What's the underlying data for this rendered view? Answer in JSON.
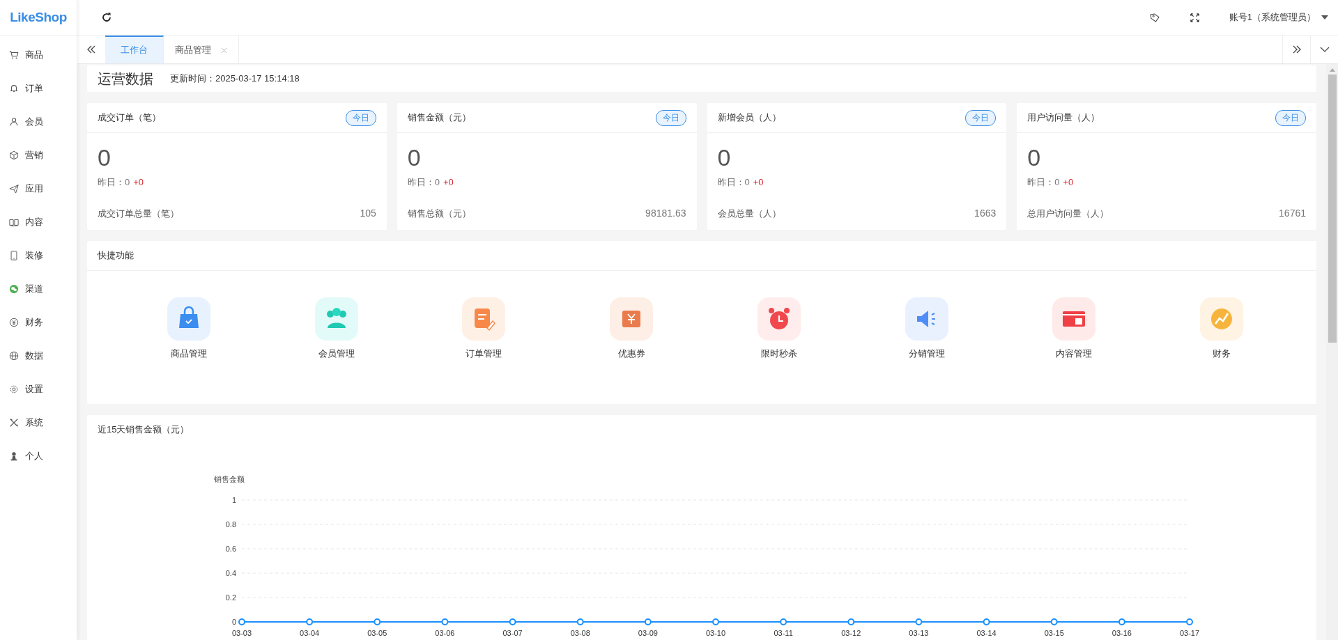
{
  "logo": {
    "part_1": "Like",
    "part_2": "Shop"
  },
  "sidebar": {
    "items": [
      {
        "label": "商品"
      },
      {
        "label": "订单"
      },
      {
        "label": "会员"
      },
      {
        "label": "营销"
      },
      {
        "label": "应用"
      },
      {
        "label": "内容"
      },
      {
        "label": "装修"
      },
      {
        "label": "渠道"
      },
      {
        "label": "财务"
      },
      {
        "label": "数据"
      },
      {
        "label": "设置"
      },
      {
        "label": "系统"
      },
      {
        "label": "个人"
      }
    ]
  },
  "header": {
    "account": "账号1（系统管理员）"
  },
  "tabs": [
    {
      "label": "工作台",
      "selected": true,
      "closable": false
    },
    {
      "label": "商品管理",
      "selected": false,
      "closable": true
    }
  ],
  "overview": {
    "title": "运营数据",
    "update_label": "更新时间：",
    "update_time": "2025-03-17 15:14:18"
  },
  "stats": [
    {
      "title": "成交订单（笔）",
      "badge": "今日",
      "value": "0",
      "yesterday_label": "昨日：",
      "yesterday_value": "0",
      "delta": "+0",
      "total_label": "成交订单总量（笔）",
      "total": "105"
    },
    {
      "title": "销售金额（元）",
      "badge": "今日",
      "value": "0",
      "yesterday_label": "昨日：",
      "yesterday_value": "0",
      "delta": "+0",
      "total_label": "销售总额（元）",
      "total": "98181.63"
    },
    {
      "title": "新增会员（人）",
      "badge": "今日",
      "value": "0",
      "yesterday_label": "昨日：",
      "yesterday_value": "0",
      "delta": "+0",
      "total_label": "会员总量（人）",
      "total": "1663"
    },
    {
      "title": "用户访问量（人）",
      "badge": "今日",
      "value": "0",
      "yesterday_label": "昨日：",
      "yesterday_value": "0",
      "delta": "+0",
      "total_label": "总用户访问量（人）",
      "total": "16761"
    }
  ],
  "quick": {
    "title": "快捷功能",
    "items": [
      {
        "label": "商品管理"
      },
      {
        "label": "会员管理"
      },
      {
        "label": "订单管理"
      },
      {
        "label": "优惠券"
      },
      {
        "label": "限时秒杀"
      },
      {
        "label": "分销管理"
      },
      {
        "label": "内容管理"
      },
      {
        "label": "财务"
      }
    ]
  },
  "sales": {
    "title": "近15天销售金额（元）",
    "chart_data": {
      "type": "line",
      "ylabel": "销售金额",
      "categories": [
        "03-03",
        "03-04",
        "03-05",
        "03-06",
        "03-07",
        "03-08",
        "03-09",
        "03-10",
        "03-11",
        "03-12",
        "03-13",
        "03-14",
        "03-15",
        "03-16",
        "03-17"
      ],
      "grid": true,
      "series": [
        {
          "color": "#1890ff",
          "marker": "circle",
          "values": [
            0,
            0,
            0,
            0,
            0,
            0,
            0,
            0,
            0,
            0,
            0,
            0,
            0,
            0,
            0
          ]
        }
      ],
      "ylim": [
        0,
        1
      ],
      "yticks": [
        {
          "value": 0,
          "label": "0"
        },
        {
          "value": 0.2,
          "label": "0.2"
        },
        {
          "value": 0.4,
          "label": "0.4"
        },
        {
          "value": 0.6,
          "label": "0.6"
        },
        {
          "value": 0.8,
          "label": "0.8"
        },
        {
          "value": 1,
          "label": "1"
        }
      ]
    }
  }
}
